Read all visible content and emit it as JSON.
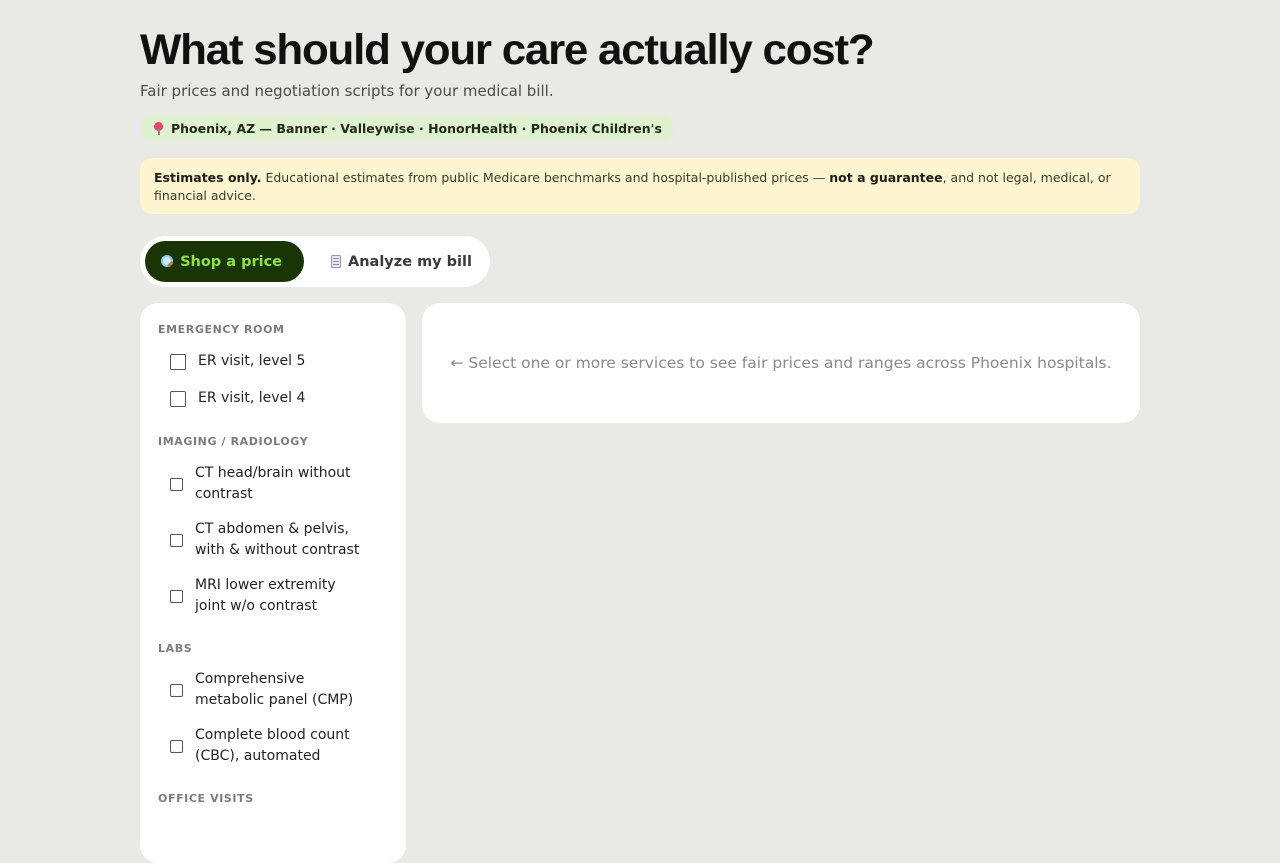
{
  "header": {
    "title": "What should your care actually cost?",
    "subtitle": "Fair prices and negotiation scripts for your medical bill.",
    "location": "Phoenix, AZ — Banner · Valleywise · HonorHealth · Phoenix Children's"
  },
  "disclaimer": {
    "lead": "Estimates only.",
    "text1": " Educational estimates from public Medicare benchmarks and hospital-published prices — ",
    "strong": "not a guarantee",
    "text2": ", and not legal, medical, or financial advice."
  },
  "tabs": [
    {
      "label": "Shop a price",
      "icon": "magnifier-icon",
      "active": true
    },
    {
      "label": "Analyze my bill",
      "icon": "receipt-icon",
      "active": false
    }
  ],
  "services": {
    "categories": [
      {
        "label": "EMERGENCY ROOM",
        "items": [
          {
            "label": "ER visit, level 5",
            "checked": false
          },
          {
            "label": "ER visit, level 4",
            "checked": false
          }
        ]
      },
      {
        "label": "IMAGING / RADIOLOGY",
        "items": [
          {
            "label": "CT head/brain without contrast",
            "checked": false
          },
          {
            "label": "CT abdomen & pelvis, with & without contrast",
            "checked": false
          },
          {
            "label": "MRI lower extremity joint w/o contrast",
            "checked": false
          }
        ]
      },
      {
        "label": "LABS",
        "items": [
          {
            "label": "Comprehensive metabolic panel (CMP)",
            "checked": false
          },
          {
            "label": "Complete blood count (CBC), automated",
            "checked": false
          }
        ]
      },
      {
        "label": "OFFICE VISITS",
        "items": []
      }
    ]
  },
  "result": {
    "placeholder": "← Select one or more services to see fair prices and ranges across Phoenix hospitals."
  }
}
